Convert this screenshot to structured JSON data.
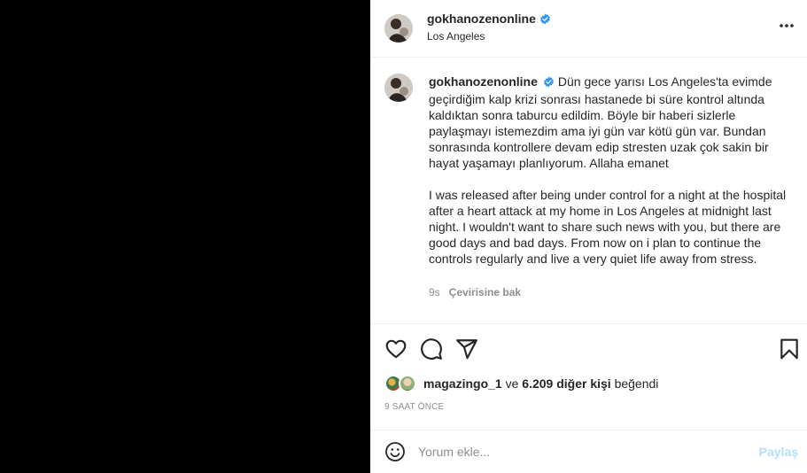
{
  "post": {
    "username": "gokhanozenonline",
    "location": "Los Angeles",
    "caption_tr": "Dün gece yarısı Los Angeles'ta evimde geçirdiğim kalp krizi sonrası hastanede bi süre kontrol altında kaldıktan sonra taburcu edildim. Böyle bir haberi sizlerle paylaşmayı istemezdim ama iyi gün var kötü gün var. Bundan sonrasında kontrollere devam edip stresten uzak çok sakin bir hayat yaşamayı planlıyorum. Allaha emanet",
    "caption_en": "I was released after being under control for a night at the hospital after a heart attack at my home in Los Angeles at midnight last night. I wouldn't want to share such news with you, but there are good days and bad days. From now on i plan to continue the controls regularly and live a very quiet life away from stress.",
    "age": "9s",
    "see_translation": "Çevirisine bak"
  },
  "likes": {
    "liker": "magazingo_1",
    "and": "ve",
    "others": "6.209 diğer kişi",
    "liked": "beğendi"
  },
  "timestamp": "9 SAAT ÖNCE",
  "comment": {
    "placeholder": "Yorum ekle...",
    "post_label": "Paylaş"
  },
  "icons": {
    "more": "more-options-icon",
    "like": "heart-icon",
    "comment": "comment-icon",
    "share": "share-icon",
    "save": "bookmark-icon",
    "emoji": "emoji-icon",
    "verified": "verified-badge-icon"
  },
  "colors": {
    "verified": "#3897f0",
    "muted": "#8e8e8e",
    "post_button_disabled": "#b2dffc"
  }
}
